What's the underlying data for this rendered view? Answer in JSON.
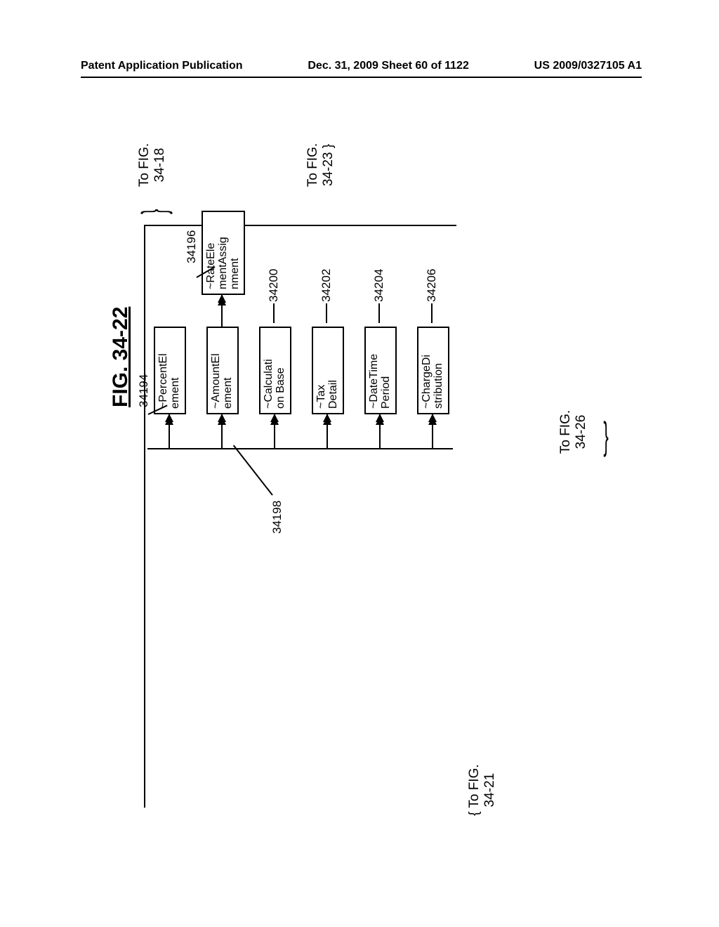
{
  "header": {
    "left": "Patent Application Publication",
    "center": "Dec. 31, 2009   Sheet 60 of 1122",
    "right": "US 2009/0327105 A1"
  },
  "figure": {
    "title": "FIG. 34-22",
    "nodes": {
      "percent": {
        "label": "~PercentEl\nement",
        "ref": "34194"
      },
      "amount": {
        "label": "~AmountEl\nement",
        "ref": "34198"
      },
      "rate": {
        "label": "~RateEle\nmentAssig\nnment",
        "ref": "34196"
      },
      "calc": {
        "label": "~Calculati\non Base",
        "ref": "34200"
      },
      "tax": {
        "label": "~Tax\nDetail",
        "ref": "34202"
      },
      "datetime": {
        "label": "~DateTime\nPeriod",
        "ref": "34204"
      },
      "charge": {
        "label": "~ChargeDi\nstribution",
        "ref": "34206"
      }
    },
    "links": {
      "to_18": "To FIG.\n34-18",
      "to_23": "To FIG.\n34-23 }",
      "to_21": "{ To FIG.\n34-21",
      "to_26": "To FIG.\n34-26"
    }
  }
}
